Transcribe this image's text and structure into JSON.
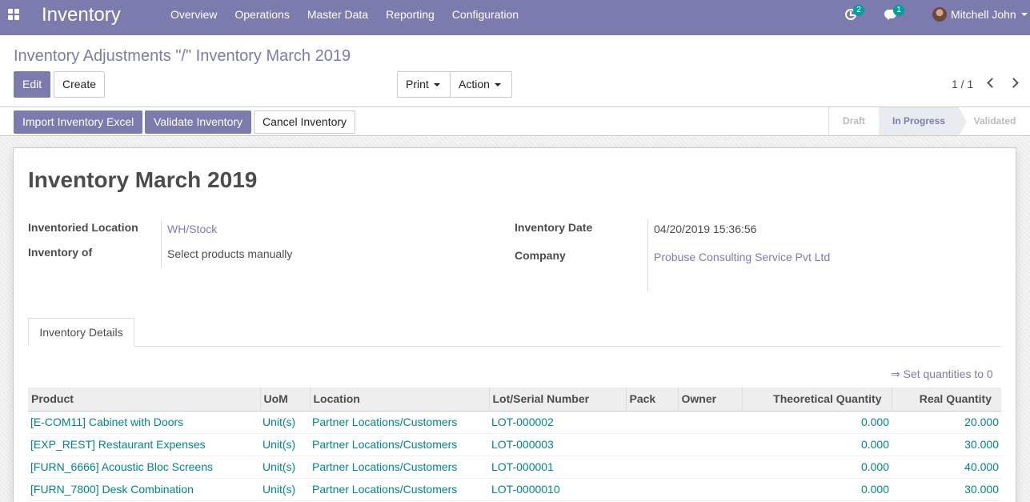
{
  "navbar": {
    "brand": "Inventory",
    "menu": [
      "Overview",
      "Operations",
      "Master Data",
      "Reporting",
      "Configuration"
    ],
    "activity_count": "2",
    "message_count": "1",
    "user_name": "Mitchell John"
  },
  "control_panel": {
    "breadcrumb_parent": "Inventory Adjustments \"/\"",
    "breadcrumb_current": "Inventory March 2019",
    "edit_label": "Edit",
    "create_label": "Create",
    "print_label": "Print",
    "action_label": "Action",
    "pager_value": "1 / 1"
  },
  "statusbar": {
    "buttons": [
      "Import Inventory Excel",
      "Validate Inventory",
      "Cancel Inventory"
    ],
    "stages": [
      "Draft",
      "In Progress",
      "Validated"
    ],
    "active_stage": "In Progress"
  },
  "form": {
    "title": "Inventory March 2019",
    "inventoried_location_label": "Inventoried Location",
    "inventoried_location": "WH/Stock",
    "inventory_of_label": "Inventory of",
    "inventory_of": "Select products manually",
    "inventory_date_label": "Inventory Date",
    "inventory_date": "04/20/2019 15:36:56",
    "company_label": "Company",
    "company": "Probuse Consulting Service Pvt Ltd"
  },
  "tab": {
    "label": "Inventory Details"
  },
  "set_quantities": "⇒ Set quantities to 0",
  "table": {
    "headers": [
      "Product",
      "UoM",
      "Location",
      "Lot/Serial Number",
      "Pack",
      "Owner",
      "Theoretical Quantity",
      "Real Quantity"
    ],
    "rows": [
      {
        "product": "[E-COM11] Cabinet with Doors",
        "uom": "Unit(s)",
        "location": "Partner Locations/Customers",
        "lot": "LOT-000002",
        "pack": "",
        "owner": "",
        "theoretical": "0.000",
        "real": "20.000"
      },
      {
        "product": "[EXP_REST] Restaurant Expenses",
        "uom": "Unit(s)",
        "location": "Partner Locations/Customers",
        "lot": "LOT-000003",
        "pack": "",
        "owner": "",
        "theoretical": "0.000",
        "real": "30.000"
      },
      {
        "product": "[FURN_6666] Acoustic Bloc Screens",
        "uom": "Unit(s)",
        "location": "Partner Locations/Customers",
        "lot": "LOT-000001",
        "pack": "",
        "owner": "",
        "theoretical": "0.000",
        "real": "40.000"
      },
      {
        "product": "[FURN_7800] Desk Combination",
        "uom": "Unit(s)",
        "location": "Partner Locations/Customers",
        "lot": "LOT-0000010",
        "pack": "",
        "owner": "",
        "theoretical": "0.000",
        "real": "30.000"
      }
    ]
  }
}
